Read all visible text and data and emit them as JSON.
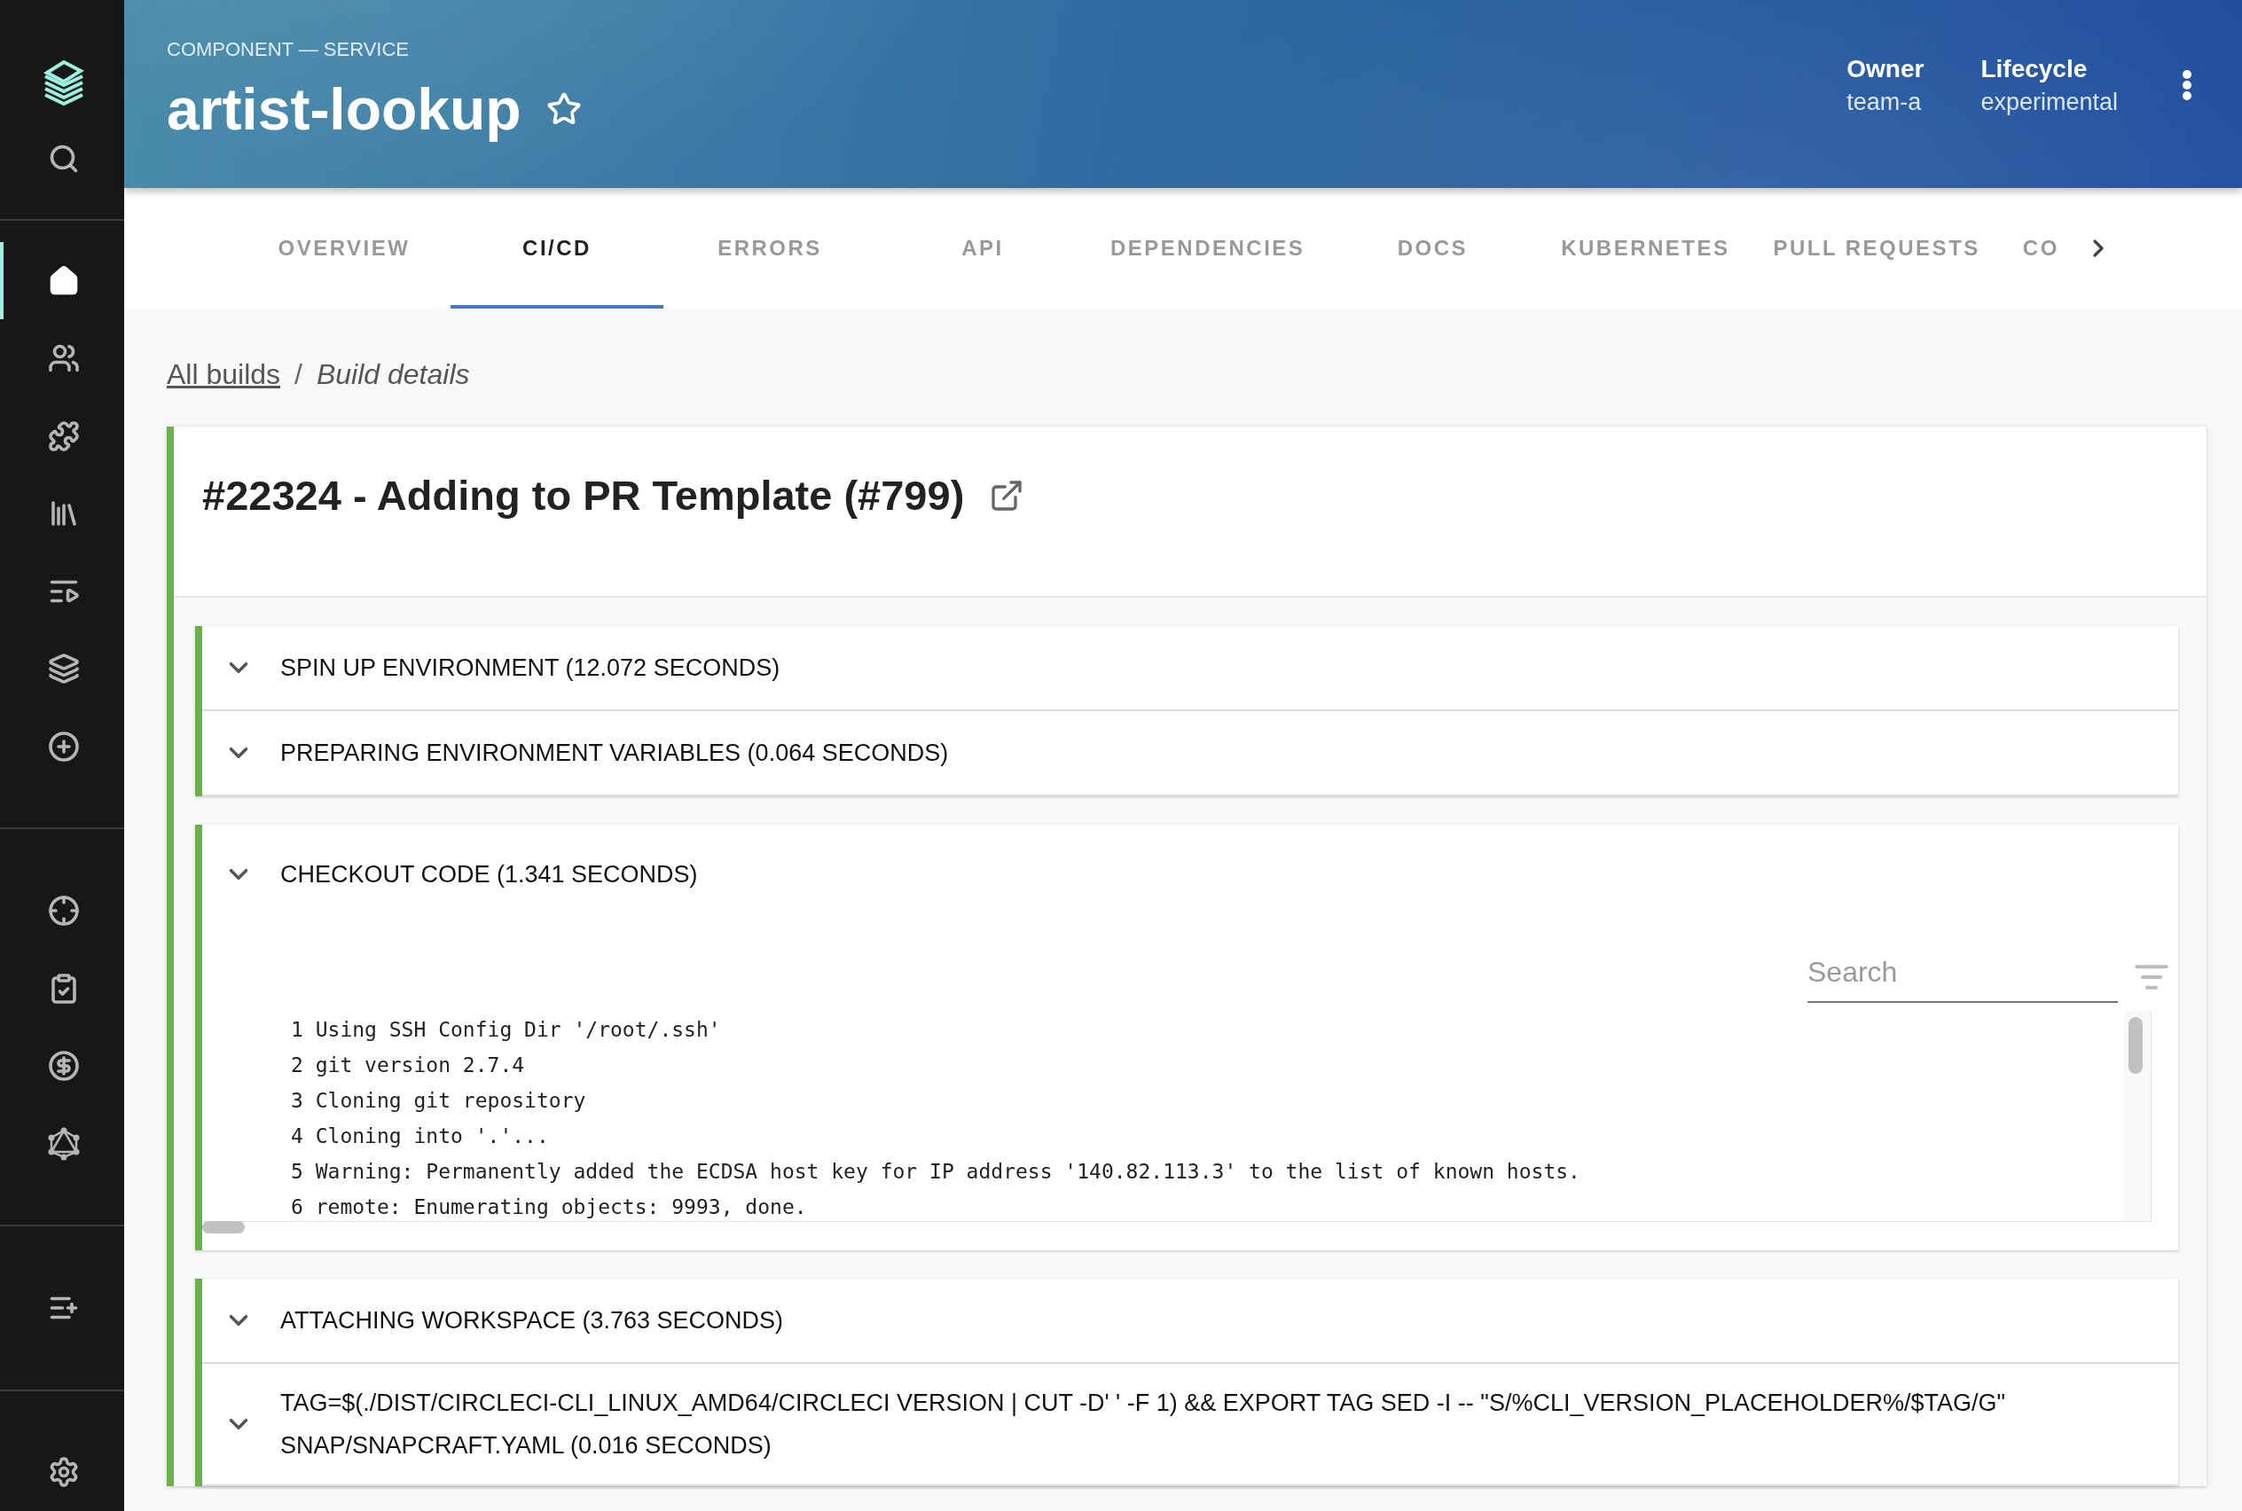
{
  "sidebar": {
    "items": [
      {
        "kind": "logo",
        "selected": false
      },
      {
        "kind": "search",
        "selected": false
      },
      {
        "kind": "divider"
      },
      {
        "kind": "home",
        "selected": true
      },
      {
        "kind": "people",
        "selected": false
      },
      {
        "kind": "puzzle",
        "selected": false
      },
      {
        "kind": "library",
        "selected": false
      },
      {
        "kind": "playlist",
        "selected": false
      },
      {
        "kind": "layers",
        "selected": false
      },
      {
        "kind": "add",
        "selected": false
      },
      {
        "kind": "divider"
      },
      {
        "kind": "target",
        "selected": false
      },
      {
        "kind": "clipboard",
        "selected": false
      },
      {
        "kind": "dollar",
        "selected": false
      },
      {
        "kind": "graph",
        "selected": false
      },
      {
        "kind": "divider"
      },
      {
        "kind": "playlist-add",
        "selected": false
      },
      {
        "kind": "divider"
      },
      {
        "kind": "settings",
        "selected": false
      }
    ]
  },
  "header": {
    "kicker": "COMPONENT — SERVICE",
    "title": "artist-lookup",
    "starred": false,
    "meta": [
      {
        "label": "Owner",
        "value": "team-a"
      },
      {
        "label": "Lifecycle",
        "value": "experimental"
      }
    ]
  },
  "tabs": [
    {
      "label": "OVERVIEW",
      "selected": false
    },
    {
      "label": "CI/CD",
      "selected": true
    },
    {
      "label": "ERRORS",
      "selected": false
    },
    {
      "label": "API",
      "selected": false
    },
    {
      "label": "DEPENDENCIES",
      "selected": false
    },
    {
      "label": "DOCS",
      "selected": false
    },
    {
      "label": "KUBERNETES",
      "selected": false
    },
    {
      "label": "PULL REQUESTS",
      "selected": false
    },
    {
      "label": "CO",
      "selected": false
    }
  ],
  "breadcrumb": {
    "link": "All builds",
    "separator": "/",
    "current": "Build details"
  },
  "build": {
    "title": "#22324 - Adding to PR Template (#799)",
    "steps": [
      {
        "title": "SPIN UP ENVIRONMENT (12.072 SECONDS)",
        "expanded": false
      },
      {
        "title": "PREPARING ENVIRONMENT VARIABLES (0.064 SECONDS)",
        "expanded": false
      },
      {
        "title": "CHECKOUT CODE (1.341 SECONDS)",
        "expanded": true,
        "search_placeholder": "Search",
        "log": [
          {
            "number": "1",
            "text": "Using SSH Config Dir '/root/.ssh'"
          },
          {
            "number": "2",
            "text": "git version 2.7.4"
          },
          {
            "number": "3",
            "text": "Cloning git repository"
          },
          {
            "number": "4",
            "text": "Cloning into '.'..."
          },
          {
            "number": "5",
            "text": "Warning: Permanently added the ECDSA host key for IP address '140.82.113.3' to the list of known hosts."
          },
          {
            "number": "6",
            "text": "remote: Enumerating objects: 9993, done."
          }
        ]
      },
      {
        "title": "ATTACHING WORKSPACE (3.763 SECONDS)",
        "expanded": false
      },
      {
        "title": "TAG=$(./DIST/CIRCLECI-CLI_LINUX_AMD64/CIRCLECI VERSION | CUT -D' ' -F 1) && EXPORT TAG SED -I -- \"S/%CLI_VERSION_PLACEHOLDER%/$TAG/G\" SNAP/SNAPCRAFT.YAML (0.016 SECONDS)",
        "expanded": false
      }
    ]
  }
}
